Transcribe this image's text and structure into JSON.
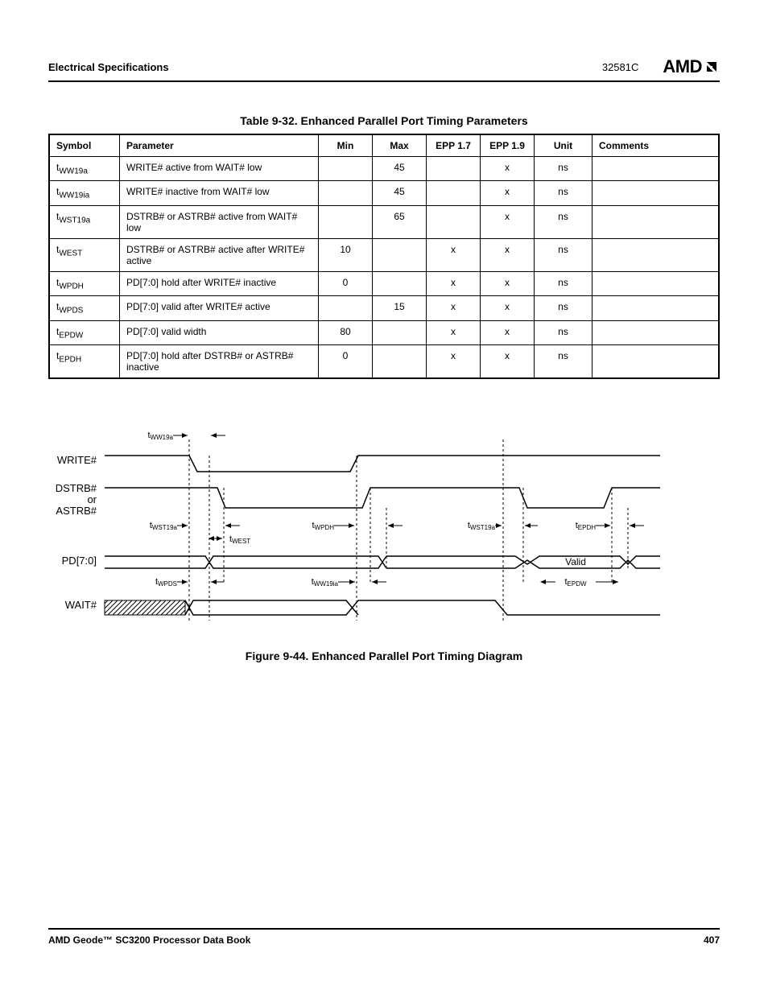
{
  "header": {
    "section": "Electrical Specifications",
    "docnum": "32581C",
    "logo": "AMD"
  },
  "table": {
    "caption": "Table 9-32.  Enhanced Parallel Port Timing Parameters",
    "headers": {
      "symbol": "Symbol",
      "parameter": "Parameter",
      "min": "Min",
      "max": "Max",
      "epp17": "EPP 1.7",
      "epp19": "EPP 1.9",
      "unit": "Unit",
      "comments": "Comments"
    },
    "rows": [
      {
        "sym_t": "t",
        "sym_sub": "WW19a",
        "param": "WRITE# active from WAIT# low",
        "min": "",
        "max": "45",
        "epp17": "",
        "epp19": "x",
        "unit": "ns",
        "comments": ""
      },
      {
        "sym_t": "t",
        "sym_sub": "WW19ia",
        "param": "WRITE# inactive from WAIT# low",
        "min": "",
        "max": "45",
        "epp17": "",
        "epp19": "x",
        "unit": "ns",
        "comments": ""
      },
      {
        "sym_t": "t",
        "sym_sub": "WST19a",
        "param": "DSTRB# or ASTRB# active from WAIT# low",
        "min": "",
        "max": "65",
        "epp17": "",
        "epp19": "x",
        "unit": "ns",
        "comments": ""
      },
      {
        "sym_t": "t",
        "sym_sub": "WEST",
        "param": "DSTRB# or ASTRB# active after WRITE# active",
        "min": "10",
        "max": "",
        "epp17": "x",
        "epp19": "x",
        "unit": "ns",
        "comments": ""
      },
      {
        "sym_t": "t",
        "sym_sub": "WPDH",
        "param": "PD[7:0] hold after WRITE# inactive",
        "min": "0",
        "max": "",
        "epp17": "x",
        "epp19": "x",
        "unit": "ns",
        "comments": ""
      },
      {
        "sym_t": "t",
        "sym_sub": "WPDS",
        "param": "PD[7:0] valid after WRITE# active",
        "min": "",
        "max": "15",
        "epp17": "x",
        "epp19": "x",
        "unit": "ns",
        "comments": ""
      },
      {
        "sym_t": "t",
        "sym_sub": "EPDW",
        "param": "PD[7:0] valid width",
        "min": "80",
        "max": "",
        "epp17": "x",
        "epp19": "x",
        "unit": "ns",
        "comments": ""
      },
      {
        "sym_t": "t",
        "sym_sub": "EPDH",
        "param": "PD[7:0] hold after DSTRB# or ASTRB# inactive",
        "min": "0",
        "max": "",
        "epp17": "x",
        "epp19": "x",
        "unit": "ns",
        "comments": ""
      }
    ]
  },
  "figure": {
    "caption": "Figure 9-44.  Enhanced Parallel Port Timing Diagram",
    "signals": {
      "write": "WRITE#",
      "dstrb": "DSTRB#",
      "or": "or",
      "astrb": "ASTRB#",
      "pd": "PD[7:0]",
      "wait": "WAIT#",
      "valid": "Valid"
    },
    "labels": {
      "tww19a": "tWW19a",
      "twst19a": "tWST19a",
      "twest": "tWEST",
      "twpdh": "tWPDH",
      "twpds": "tWPDS",
      "tww19ia": "tWW19ia",
      "tepdh": "tEPDH",
      "tepdw": "tEPDW"
    }
  },
  "footer": {
    "book": "AMD Geode™ SC3200 Processor Data Book",
    "page": "407"
  }
}
